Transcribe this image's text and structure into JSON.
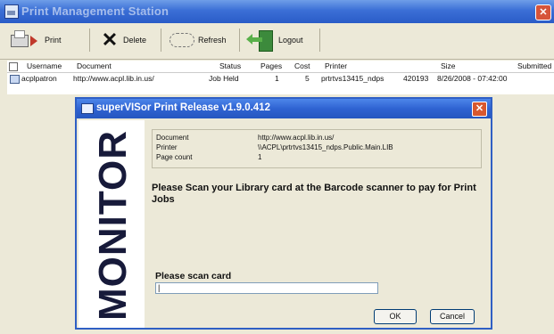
{
  "window": {
    "title": "Print Management Station",
    "close_glyph": "✕"
  },
  "toolbar": {
    "print_label": "Print",
    "delete_label": "Delete",
    "refresh_label": "Refresh",
    "logout_label": "Logout"
  },
  "table": {
    "headers": [
      "Username",
      "Document",
      "Status",
      "Pages",
      "Cost",
      "Printer",
      "Size",
      "Submitted"
    ],
    "rows": [
      {
        "username": "acplpatron",
        "document": "http://www.acpl.lib.in.us/",
        "status": "Job Held",
        "pages": "1",
        "cost": "5",
        "printer": "prtrtvs13415_ndps",
        "size": "420193",
        "submitted": "8/26/2008 - 07:42:00"
      }
    ]
  },
  "dialog": {
    "title": "superVISor Print Release v1.9.0.412",
    "close_glyph": "✕",
    "brand_vertical": "MONITOR",
    "info": {
      "document_label": "Document",
      "document_value": "http://www.acpl.lib.in.us/",
      "printer_label": "Printer",
      "printer_value": "\\\\ACPL\\prtrtvs13415_ndps.Public.Main.LIB",
      "page_count_label": "Page count",
      "page_count_value": "1"
    },
    "message": "Please Scan your Library card at the Barcode scanner to pay for Print Jobs",
    "scan_label": "Please scan card",
    "scan_value": "|",
    "ok_label": "OK",
    "cancel_label": "Cancel"
  },
  "colors": {
    "titlebar": "#2a5cc7",
    "dialog_titlebar": "#2f63d2",
    "close_button": "#d6543a",
    "window_bg": "#ece9d8"
  },
  "icons": {
    "print": "printer-arrow-icon",
    "delete": "x-icon",
    "refresh": "refresh-icon",
    "logout": "door-exit-icon"
  }
}
